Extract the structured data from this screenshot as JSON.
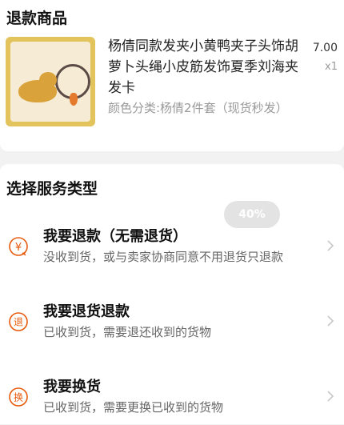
{
  "refund_goods": {
    "section_title": "退款商品",
    "product": {
      "title": "杨倩同款发夹小黄鸭夹子头饰胡萝卜头绳小皮筋发饰夏季刘海夹发卡",
      "price": "7.00",
      "quantity": "x1",
      "spec": "颜色分类:杨倩2件套（现货秒发）",
      "image_alt": "product-photo"
    }
  },
  "service": {
    "section_title": "选择服务类型",
    "progress": "40%",
    "options": [
      {
        "title": "我要退款（无需退货）",
        "desc": "没收到货，或与卖家协商同意不用退货只退款",
        "icon_glyph": "¥"
      },
      {
        "title": "我要退货退款",
        "desc": "已收到货，需要退还收到的货物",
        "icon_glyph": "退"
      },
      {
        "title": "我要换货",
        "desc": "已收到货，需要更换已收到的货物",
        "icon_glyph": "换"
      }
    ]
  },
  "colors": {
    "accent": "#e8590c",
    "muted_text": "#999999",
    "background": "#f2f2f2"
  }
}
